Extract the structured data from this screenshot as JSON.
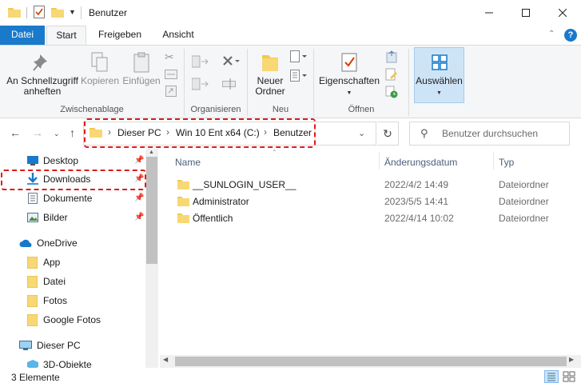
{
  "window": {
    "title": "Benutzer",
    "controls": {
      "minimize": "minimize-icon",
      "maximize": "maximize-icon",
      "close": "close-icon"
    }
  },
  "ribbon_tabs": [
    "Datei",
    "Start",
    "Freigeben",
    "Ansicht"
  ],
  "ribbon": {
    "pin_quick_access": "An Schnellzugriff anheften",
    "copy": "Kopieren",
    "paste": "Einfügen",
    "new_folder": "Neuer Ordner",
    "properties": "Eigenschaften",
    "select": "Auswählen",
    "groups": {
      "clipboard": "Zwischenablage",
      "organize": "Organisieren",
      "new": "Neu",
      "open": "Öffnen"
    }
  },
  "address": {
    "crumbs": [
      "Dieser PC",
      "Win 10 Ent x64 (C:)",
      "Benutzer"
    ],
    "search_placeholder": "Benutzer durchsuchen"
  },
  "nav_pane": {
    "items": [
      {
        "label": "Desktop",
        "icon": "desktop-icon",
        "pinned": true
      },
      {
        "label": "Downloads",
        "icon": "download-icon",
        "pinned": true
      },
      {
        "label": "Dokumente",
        "icon": "documents-icon",
        "pinned": true
      },
      {
        "label": "Bilder",
        "icon": "pictures-icon",
        "pinned": true
      },
      {
        "label": "OneDrive",
        "icon": "onedrive-icon"
      },
      {
        "label": "App",
        "icon": "folder-icon"
      },
      {
        "label": "Datei",
        "icon": "folder-icon"
      },
      {
        "label": "Fotos",
        "icon": "folder-icon"
      },
      {
        "label": "Google Fotos",
        "icon": "folder-icon"
      },
      {
        "label": "Dieser PC",
        "icon": "computer-icon"
      },
      {
        "label": "3D-Objekte",
        "icon": "3d-objects-icon"
      }
    ]
  },
  "file_list": {
    "columns": {
      "name": "Name",
      "date": "Änderungsdatum",
      "type": "Typ"
    },
    "rows": [
      {
        "name": "__SUNLOGIN_USER__",
        "date": "2022/4/2 14:49",
        "type": "Dateiordner"
      },
      {
        "name": "Administrator",
        "date": "2023/5/5 14:41",
        "type": "Dateiordner"
      },
      {
        "name": "Öffentlich",
        "date": "2022/4/14 10:02",
        "type": "Dateiordner"
      }
    ]
  },
  "status_bar": {
    "count": "3 Elemente"
  },
  "colors": {
    "accent": "#1979ca",
    "folder": "#f4c84a",
    "highlight_dash": "#e01b1b",
    "selected_button": "#cde4f7"
  }
}
